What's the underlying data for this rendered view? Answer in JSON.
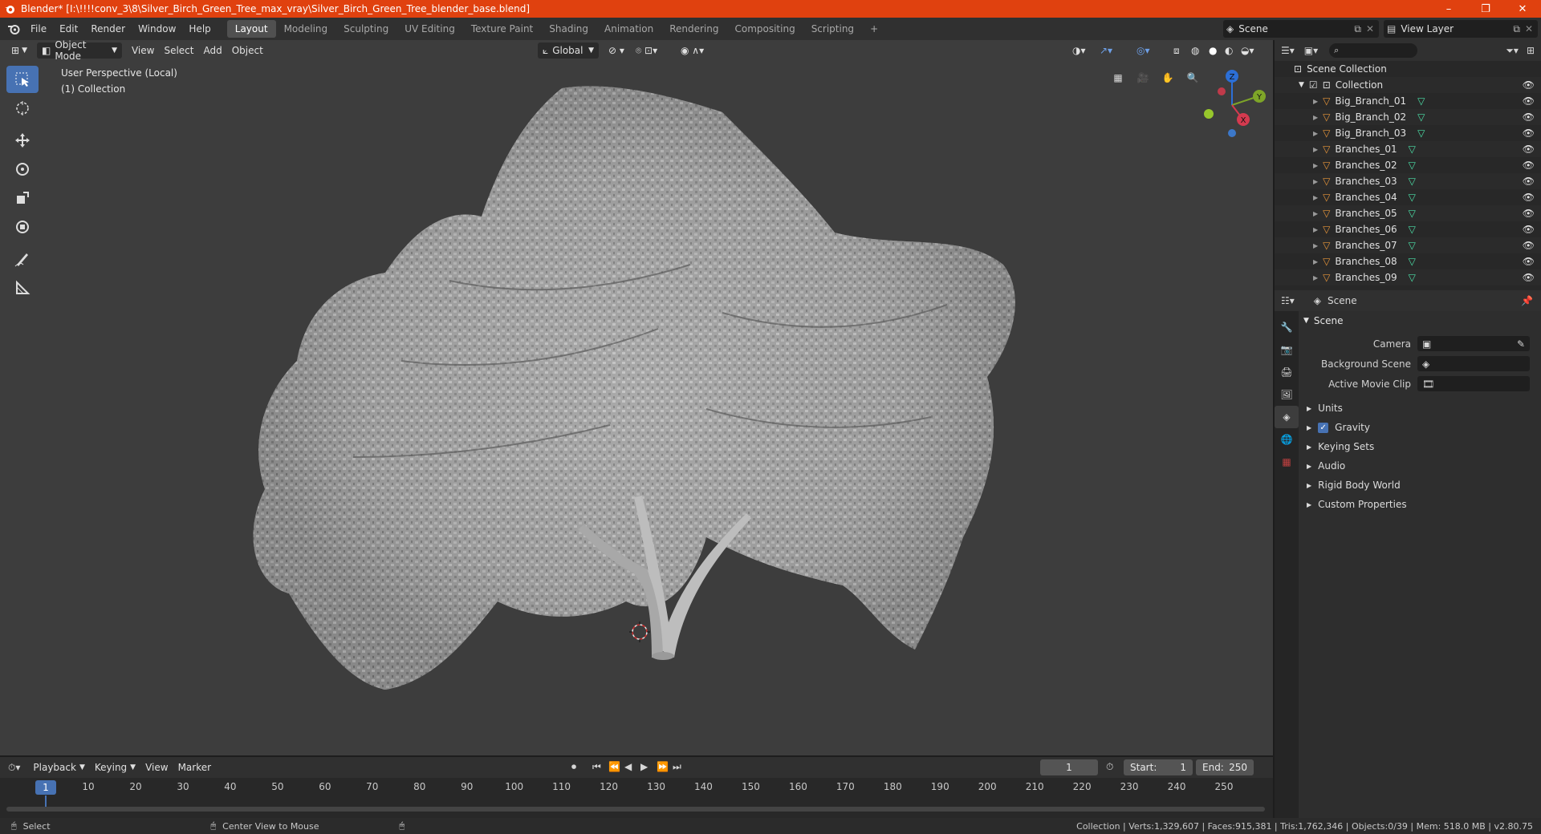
{
  "window": {
    "title": "Blender* [I:\\!!!!conv_3\\8\\Silver_Birch_Green_Tree_max_vray\\Silver_Birch_Green_Tree_blender_base.blend]",
    "controls": [
      "–",
      "❐",
      "✕"
    ]
  },
  "menu": {
    "items": [
      "File",
      "Edit",
      "Render",
      "Window",
      "Help"
    ],
    "workspaces": [
      "Layout",
      "Modeling",
      "Sculpting",
      "UV Editing",
      "Texture Paint",
      "Shading",
      "Animation",
      "Rendering",
      "Compositing",
      "Scripting"
    ],
    "active_workspace": "Layout",
    "add_tab": "+",
    "scene": "Scene",
    "view_layer": "View Layer"
  },
  "viewport": {
    "mode": "Object Mode",
    "menus": [
      "View",
      "Select",
      "Add",
      "Object"
    ],
    "orientation": "Global",
    "perspective_label": "User Perspective (Local)",
    "collection_label": "(1) Collection",
    "gizmo_axes": {
      "z": "Z",
      "y": "Y",
      "x": "X"
    },
    "accent_color": "#4772b3"
  },
  "outliner": {
    "root": "Scene Collection",
    "collection": "Collection",
    "objects": [
      "Big_Branch_01",
      "Big_Branch_02",
      "Big_Branch_03",
      "Branches_01",
      "Branches_02",
      "Branches_03",
      "Branches_04",
      "Branches_05",
      "Branches_06",
      "Branches_07",
      "Branches_08",
      "Branches_09"
    ]
  },
  "properties": {
    "context": "Scene",
    "panel_title": "Scene",
    "fields": {
      "camera_label": "Camera",
      "background_scene_label": "Background Scene",
      "active_movie_clip_label": "Active Movie Clip"
    },
    "subpanels": [
      "Units",
      "Gravity",
      "Keying Sets",
      "Audio",
      "Rigid Body World",
      "Custom Properties"
    ],
    "gravity_checked": true
  },
  "timeline": {
    "menus": [
      "Playback",
      "Keying",
      "View",
      "Marker"
    ],
    "current_frame": "1",
    "start_label": "Start:",
    "start": "1",
    "end_label": "End:",
    "end": "250",
    "ruler_marks": [
      "1",
      "10",
      "20",
      "30",
      "40",
      "50",
      "60",
      "70",
      "80",
      "90",
      "100",
      "110",
      "120",
      "130",
      "140",
      "150",
      "160",
      "170",
      "180",
      "190",
      "200",
      "210",
      "220",
      "230",
      "240",
      "250"
    ]
  },
  "statusbar": {
    "select": "Select",
    "center_view": "Center View to Mouse",
    "stats": "Collection | Verts:1,329,607 | Faces:915,381 | Tris:1,762,346 | Objects:0/39 | Mem: 518.0 MB | v2.80.75"
  }
}
